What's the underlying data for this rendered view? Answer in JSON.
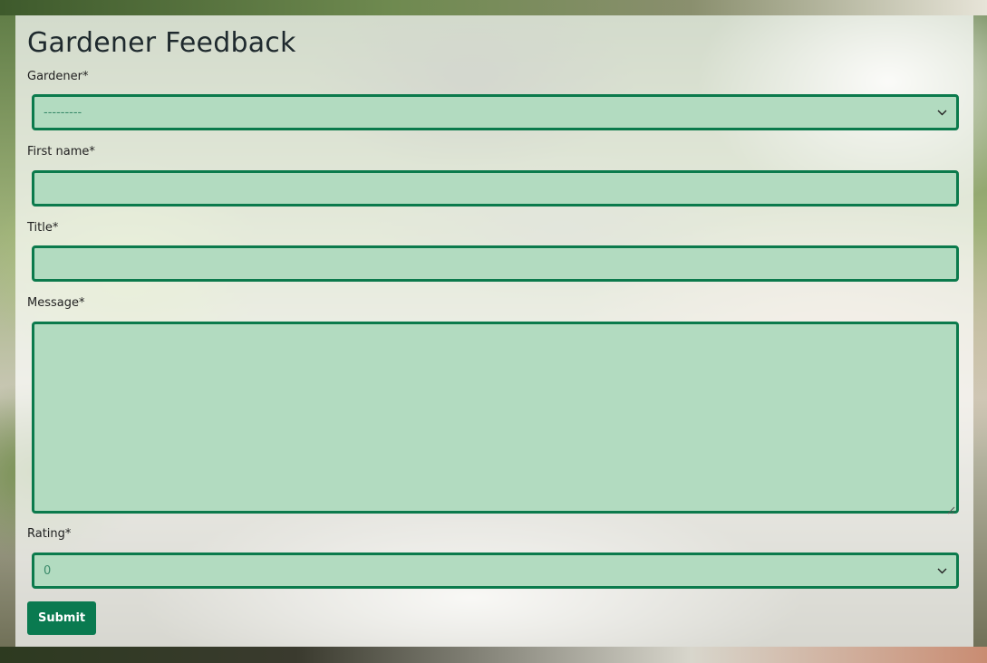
{
  "form": {
    "title": "Gardener Feedback",
    "gardener": {
      "label": "Gardener*",
      "selected": "---------"
    },
    "first_name": {
      "label": "First name*",
      "value": ""
    },
    "title_field": {
      "label": "Title*",
      "value": ""
    },
    "message": {
      "label": "Message*",
      "value": ""
    },
    "rating": {
      "label": "Rating*",
      "selected": "0"
    },
    "submit_label": "Submit"
  },
  "colors": {
    "field_background": "#b2dbc0",
    "field_border": "#0b7a4c",
    "button_background": "#0a7a50"
  },
  "icons": {
    "select_arrow": "chevron-down-icon",
    "textarea_resize": "resize-grip-icon"
  }
}
